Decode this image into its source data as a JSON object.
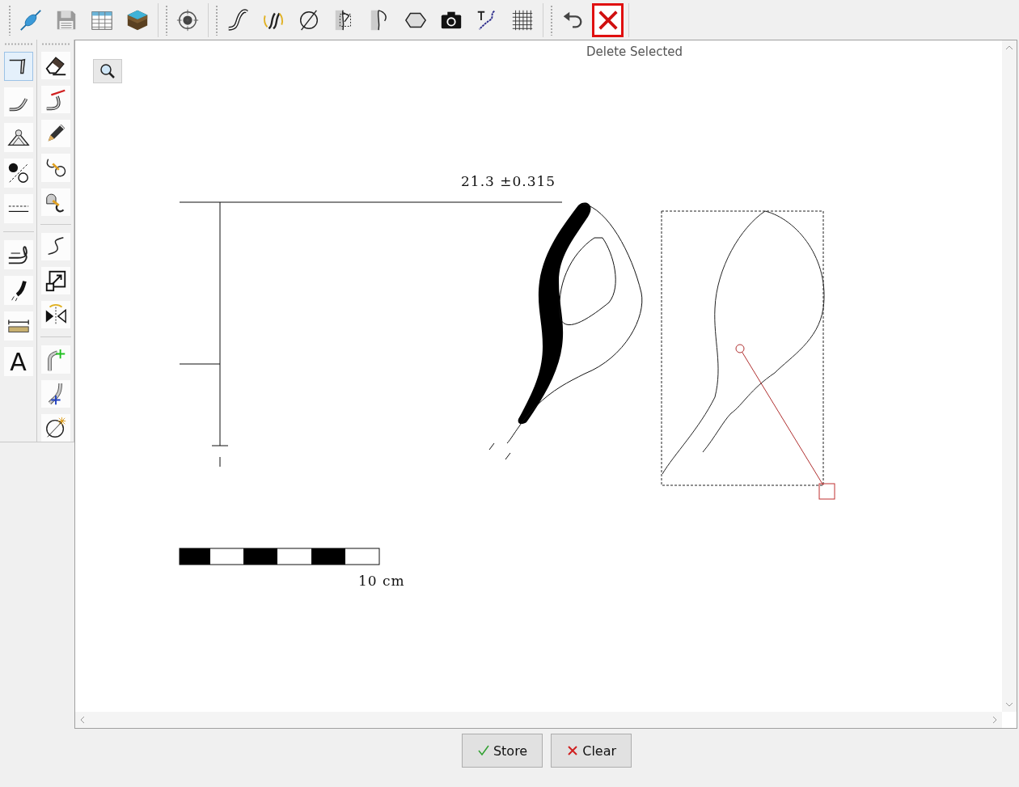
{
  "toolbar": {
    "groups": [
      {
        "buttons": [
          {
            "selected": false
          },
          {
            "selected": false
          },
          {
            "selected": false
          },
          {
            "selected": false
          }
        ]
      },
      {
        "buttons": [
          {
            "selected": false
          }
        ]
      },
      {
        "buttons": [
          {
            "selected": false
          },
          {
            "selected": false
          },
          {
            "selected": false
          },
          {
            "selected": false
          },
          {
            "selected": false
          },
          {
            "selected": false
          },
          {
            "selected": false
          },
          {
            "selected": false
          },
          {
            "selected": false
          }
        ]
      },
      {
        "buttons": [
          {
            "selected": false
          },
          {
            "selected": true
          }
        ]
      }
    ]
  },
  "tooltip": "Delete Selected",
  "palette": {
    "columns": [
      {
        "groups": [
          [
            {
              "selected": true
            },
            {
              "selected": false
            },
            {
              "selected": false
            },
            {
              "selected": false
            },
            {
              "selected": false
            }
          ],
          [
            {
              "selected": false
            },
            {
              "selected": false
            },
            {
              "selected": false
            },
            {
              "selected": false,
              "glyph": "A"
            }
          ]
        ]
      },
      {
        "groups": [
          [
            {
              "selected": false
            },
            {
              "selected": false
            },
            {
              "selected": false
            },
            {
              "selected": false
            },
            {
              "selected": false
            }
          ],
          [
            {
              "selected": false
            },
            {
              "selected": false
            },
            {
              "selected": false
            }
          ],
          [
            {
              "selected": false
            },
            {
              "selected": false
            },
            {
              "selected": false
            }
          ]
        ]
      }
    ]
  },
  "canvas": {
    "measurement": "21.3 ±0.315",
    "scale_label": "10 cm"
  },
  "buttons": [
    {
      "kind": "store",
      "label": "Store"
    },
    {
      "kind": "clear",
      "label": "Clear"
    }
  ]
}
